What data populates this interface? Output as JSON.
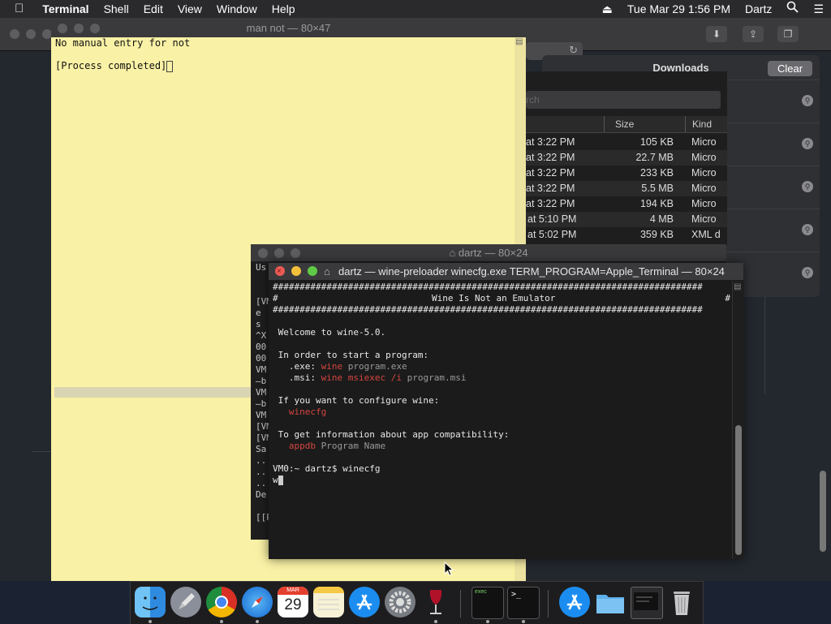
{
  "menubar": {
    "apple_icon": "",
    "app_name": "Terminal",
    "menus": [
      "Shell",
      "Edit",
      "View",
      "Window",
      "Help"
    ],
    "datetime": "Tue Mar 29  1:56 PM",
    "user": "Dartz"
  },
  "downloads": {
    "title": "Downloads",
    "clear_label": "Clear"
  },
  "list_window": {
    "search_placeholder": "rch",
    "headers": {
      "size": "Size",
      "kind": "Kind"
    },
    "rows": [
      {
        "date": "at 3:22 PM",
        "size": "105 KB",
        "kind": "Micro"
      },
      {
        "date": "at 3:22 PM",
        "size": "22.7 MB",
        "kind": "Micro"
      },
      {
        "date": "at 3:22 PM",
        "size": "233 KB",
        "kind": "Micro"
      },
      {
        "date": "at 3:22 PM",
        "size": "5.5 MB",
        "kind": "Micro"
      },
      {
        "date": "at 3:22 PM",
        "size": "194 KB",
        "kind": "Micro"
      },
      {
        "date": "at 5:10 PM",
        "size": "4 MB",
        "kind": "Micro"
      },
      {
        "date": "at 5:02 PM",
        "size": "359 KB",
        "kind": "XML d"
      }
    ]
  },
  "man_window": {
    "title": "man not — 80×47",
    "line1": "No manual entry for not",
    "line2": "[Process completed]"
  },
  "dartz_window": {
    "title": "dartz — 80×24",
    "partial_text": "Us\n\n\n[VM\ne\ns\n^X\n00\n00\nVM\n–b\nVM\n–b\nVM\n[VM\n[VM\nSa\n..\n..\n..\nDe\n\n[[P"
  },
  "wine_window": {
    "title": "dartz — wine-preloader winecfg.exe TERM_PROGRAM=Apple_Terminal — 80×24",
    "hash_line": "################################################################################",
    "banner_left": "#",
    "banner_center": "Wine Is Not an Emulator",
    "banner_right": "#",
    "welcome": "Welcome to wine-5.0.",
    "start_intro": "In order to start a program:",
    "exe_label": ".exe:",
    "exe_cmd": "wine",
    "exe_arg": "program.exe",
    "msi_label": ".msi:",
    "msi_cmd": "wine msiexec /i",
    "msi_arg": "program.msi",
    "config_intro": "If you want to configure wine:",
    "config_cmd": "winecfg",
    "compat_intro": "To get information about app compatibility:",
    "compat_cmd": "appdb",
    "compat_arg": "Program Name",
    "prompt": "VM0:~ dartz$ winecfg",
    "typed": "w"
  },
  "dock": {
    "apps": [
      "finder-icon",
      "launchpad-icon",
      "chrome-icon",
      "safari-icon",
      "calendar-icon",
      "notes-icon",
      "app-store-icon",
      "system-preferences-icon",
      "wine-icon",
      "exec-terminal-icon",
      "terminal-icon",
      "app-store-folder-icon",
      "folder-icon",
      "screen-icon",
      "trash-icon"
    ],
    "calendar_month": "MAR",
    "calendar_day": "29",
    "exec_label": "exec",
    "terminal_prompt": ">_"
  }
}
